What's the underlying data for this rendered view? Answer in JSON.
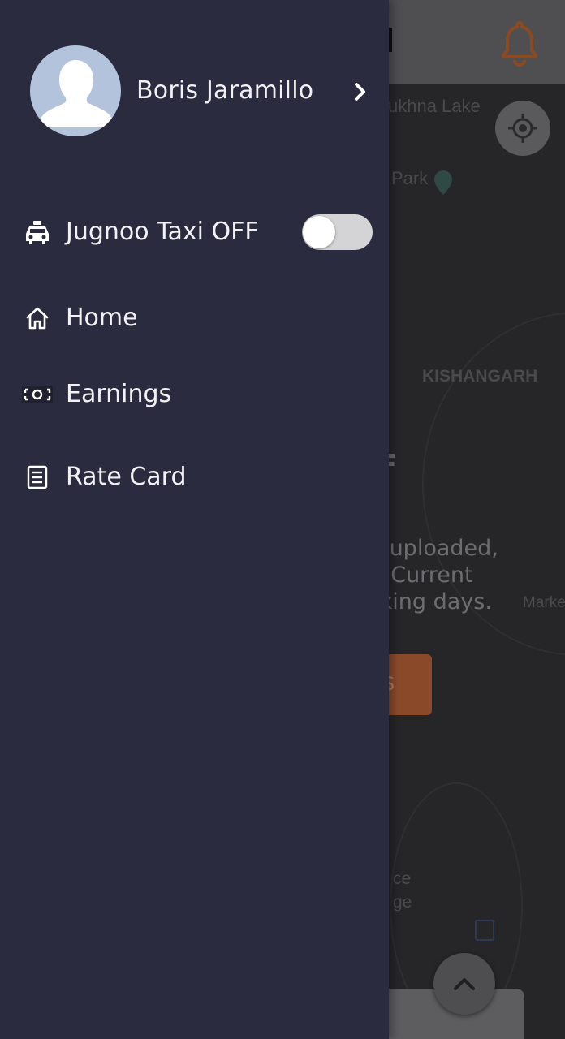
{
  "drawer": {
    "profile": {
      "name": "Boris Jaramillo"
    },
    "duty": {
      "label": "Jugnoo Taxi OFF",
      "toggle_on": false
    },
    "menu": [
      {
        "label": "Home",
        "icon": "home-icon"
      },
      {
        "label": "Earnings",
        "icon": "cash-icon"
      },
      {
        "label": "Rate Card",
        "icon": "list-icon"
      }
    ]
  },
  "background": {
    "map_labels": [
      "ukhna Lake",
      "Park",
      "KISHANGARH",
      "ce",
      "ge",
      "Marke"
    ],
    "status_title": "FF",
    "status_lines": [
      "lly uploaded,",
      "al. Current",
      "orking days."
    ],
    "button_label": "S"
  },
  "colors": {
    "drawer_bg": "#2a2b3f",
    "accent": "#e87722",
    "text": "#f2f2f5"
  }
}
